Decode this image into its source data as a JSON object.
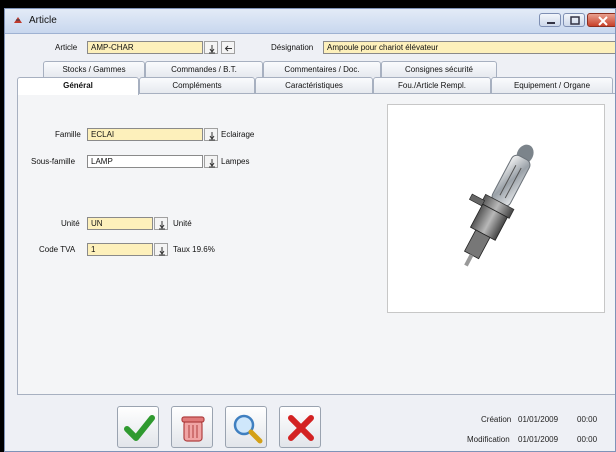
{
  "window": {
    "title": "Article"
  },
  "header": {
    "article_label": "Article",
    "article_value": "AMP-CHAR",
    "designation_label": "Désignation",
    "designation_value": "Ampoule pour chariot élévateur"
  },
  "tabs_row1": [
    {
      "label": "Stocks / Gammes"
    },
    {
      "label": "Commandes / B.T."
    },
    {
      "label": "Commentaires / Doc."
    },
    {
      "label": "Consignes sécurité"
    }
  ],
  "tabs_row2": [
    {
      "label": "Général",
      "active": true
    },
    {
      "label": "Compléments"
    },
    {
      "label": "Caractéristiques"
    },
    {
      "label": "Fou./Article Rempl."
    },
    {
      "label": "Equipement / Organe"
    }
  ],
  "form": {
    "famille_label": "Famille",
    "famille_value": "ECLAI",
    "famille_desc": "Eclairage",
    "sousfamille_label": "Sous-famille",
    "sousfamille_value": "LAMP",
    "sousfamille_desc": "Lampes",
    "unite_label": "Unité",
    "unite_value": "UN",
    "unite_desc": "Unité",
    "tva_label": "Code TVA",
    "tva_value": "1",
    "tva_desc": "Taux 19.6%"
  },
  "image": {
    "icon": "halogen-bulb-photo"
  },
  "footer": {
    "creation_label": "Création",
    "creation_date": "01/01/2009",
    "creation_time": "00:00",
    "modification_label": "Modification",
    "modification_date": "01/01/2009",
    "modification_time": "00:00"
  },
  "buttons": {
    "validate_icon": "checkmark-icon",
    "delete_icon": "trash-icon",
    "search_icon": "magnifier-icon",
    "cancel_icon": "red-x-icon"
  },
  "colors": {
    "field_yellow": "#fdf0bb",
    "accent_green": "#2f9a2f",
    "cancel_red": "#d32222"
  }
}
